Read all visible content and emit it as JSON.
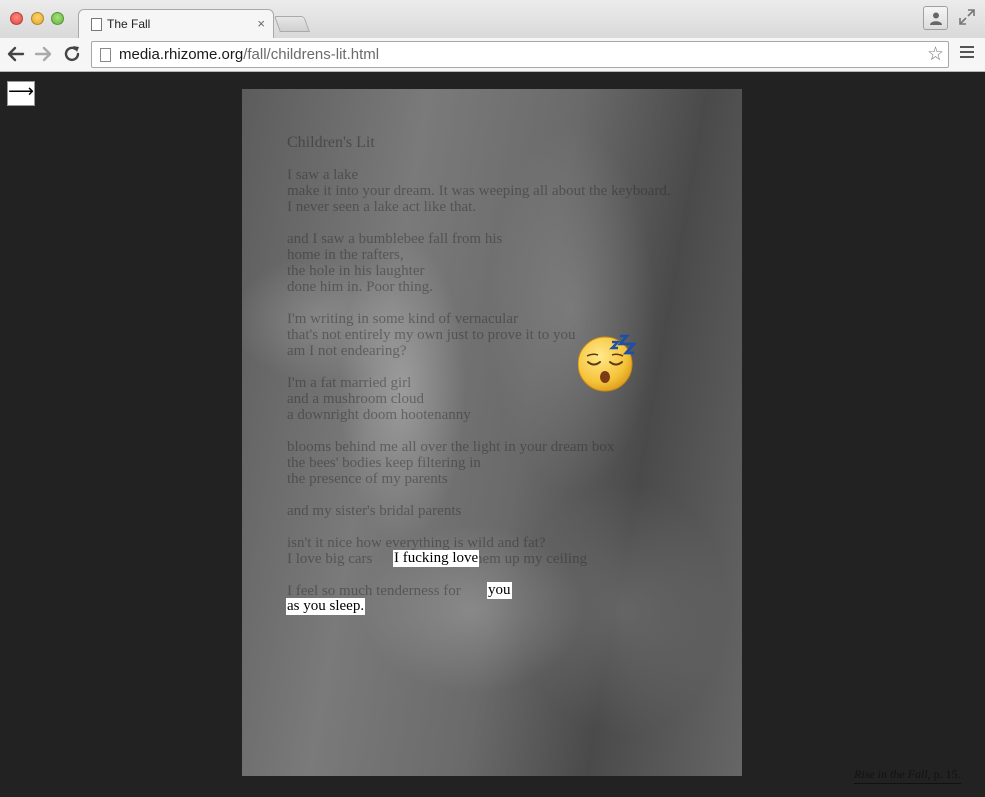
{
  "window": {
    "tab_title": "The Fall",
    "tab_close": "×"
  },
  "toolbar": {
    "url_host": "media.rhizome.org",
    "url_path": "/fall/childrens-lit.html",
    "bookmark_star": "☆"
  },
  "page": {
    "next_arrow": "⟶",
    "poem": {
      "title": "Children's Lit",
      "text": "I saw a lake\nmake it into your dream. It was weeping all about the keyboard.\nI never seen a lake act like that.\n\nand I saw a bumblebee fall from his\nhome in the rafters,\nthe hole in his laughter\ndone him in. Poor thing.\n\nI'm writing in some kind of vernacular\nthat's not entirely my own just to prove it to you\nam I not endearing?\n\nI'm a fat married girl\nand a mushroom cloud\na downright doom hootenanny\n\nblooms behind me all over the light in your dream box\nthe bees' bodies keep filtering in\nthe presence of my parents\n\nand my sister's bridal parents\n\nisn't it nice how everything is wild and fat?\nI love big cars                  stuff them up my ceiling\n\nI feel so much tenderness for"
    },
    "highlights": {
      "line1": "I fucking love",
      "line2": "you",
      "line3": "as you sleep."
    },
    "caption": {
      "title": "Rise in the Fall",
      "suffix": ", p. 15."
    }
  }
}
